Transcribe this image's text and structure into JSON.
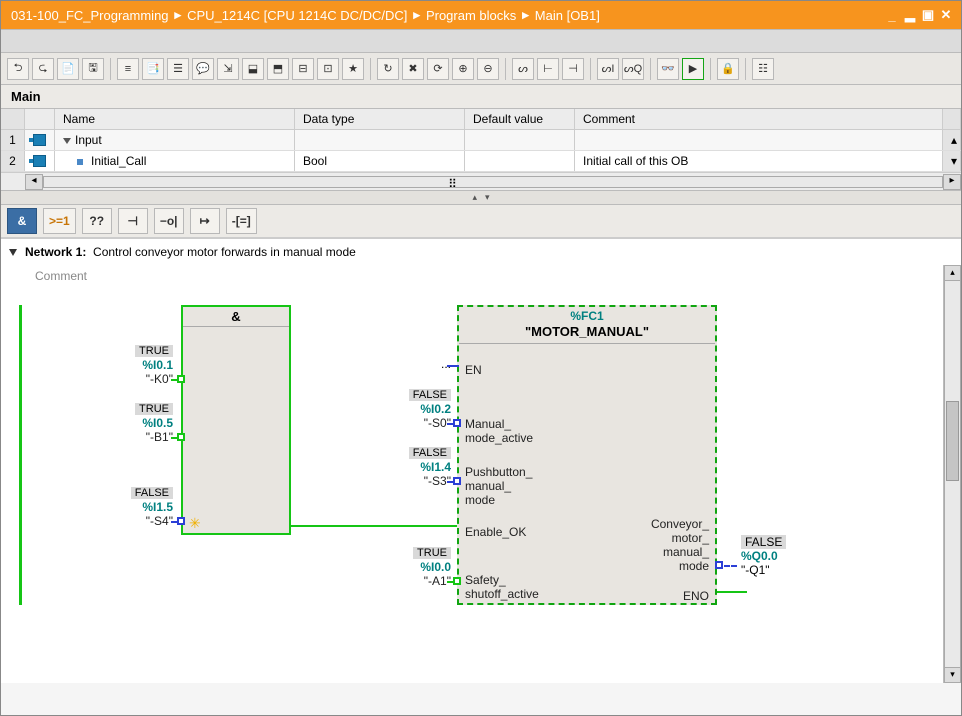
{
  "breadcrumb": [
    "031-100_FC_Programming",
    "CPU_1214C [CPU 1214C DC/DC/DC]",
    "Program blocks",
    "Main [OB1]"
  ],
  "block_title": "Main",
  "grid": {
    "headers": [
      "Name",
      "Data type",
      "Default value",
      "Comment"
    ],
    "rows": [
      {
        "num": "1",
        "name": "Input",
        "dtype": "",
        "def": "",
        "comment": "",
        "kind": "group"
      },
      {
        "num": "2",
        "name": "Initial_Call",
        "dtype": "Bool",
        "def": "",
        "comment": "Initial call of this OB",
        "kind": "var"
      }
    ]
  },
  "lad_toolbar": [
    "&",
    ">=1",
    "??",
    "⊣",
    "−o|",
    "↦",
    "-[=]"
  ],
  "network": {
    "label": "Network 1:",
    "title": "Control conveyor motor forwards in manual mode",
    "comment_placeholder": "Comment"
  },
  "and_block": {
    "op": "&"
  },
  "fc_block": {
    "addr": "%FC1",
    "name": "\"MOTOR_MANUAL\"",
    "inputs": [
      "EN",
      "Manual_\nmode_active",
      "Pushbutton_\nmanual_\nmode",
      "Enable_OK",
      "Safety_\nshutoff_active"
    ],
    "outputs": [
      "Conveyor_\nmotor_\nmanual_\nmode",
      "ENO"
    ]
  },
  "signals": {
    "and_in": [
      {
        "state": "TRUE",
        "addr": "%I0.1",
        "tag": "\"-K0\""
      },
      {
        "state": "TRUE",
        "addr": "%I0.5",
        "tag": "\"-B1\""
      },
      {
        "state": "FALSE",
        "addr": "%I1.5",
        "tag": "\"-S4\""
      }
    ],
    "fc_in": [
      {
        "state": "...",
        "addr": "",
        "tag": ""
      },
      {
        "state": "FALSE",
        "addr": "%I0.2",
        "tag": "\"-S0\""
      },
      {
        "state": "FALSE",
        "addr": "%I1.4",
        "tag": "\"-S3\""
      },
      {
        "state": "",
        "addr": "",
        "tag": ""
      },
      {
        "state": "TRUE",
        "addr": "%I0.0",
        "tag": "\"-A1\""
      }
    ],
    "fc_out": [
      {
        "state": "FALSE",
        "addr": "%Q0.0",
        "tag": "\"-Q1\""
      }
    ]
  }
}
